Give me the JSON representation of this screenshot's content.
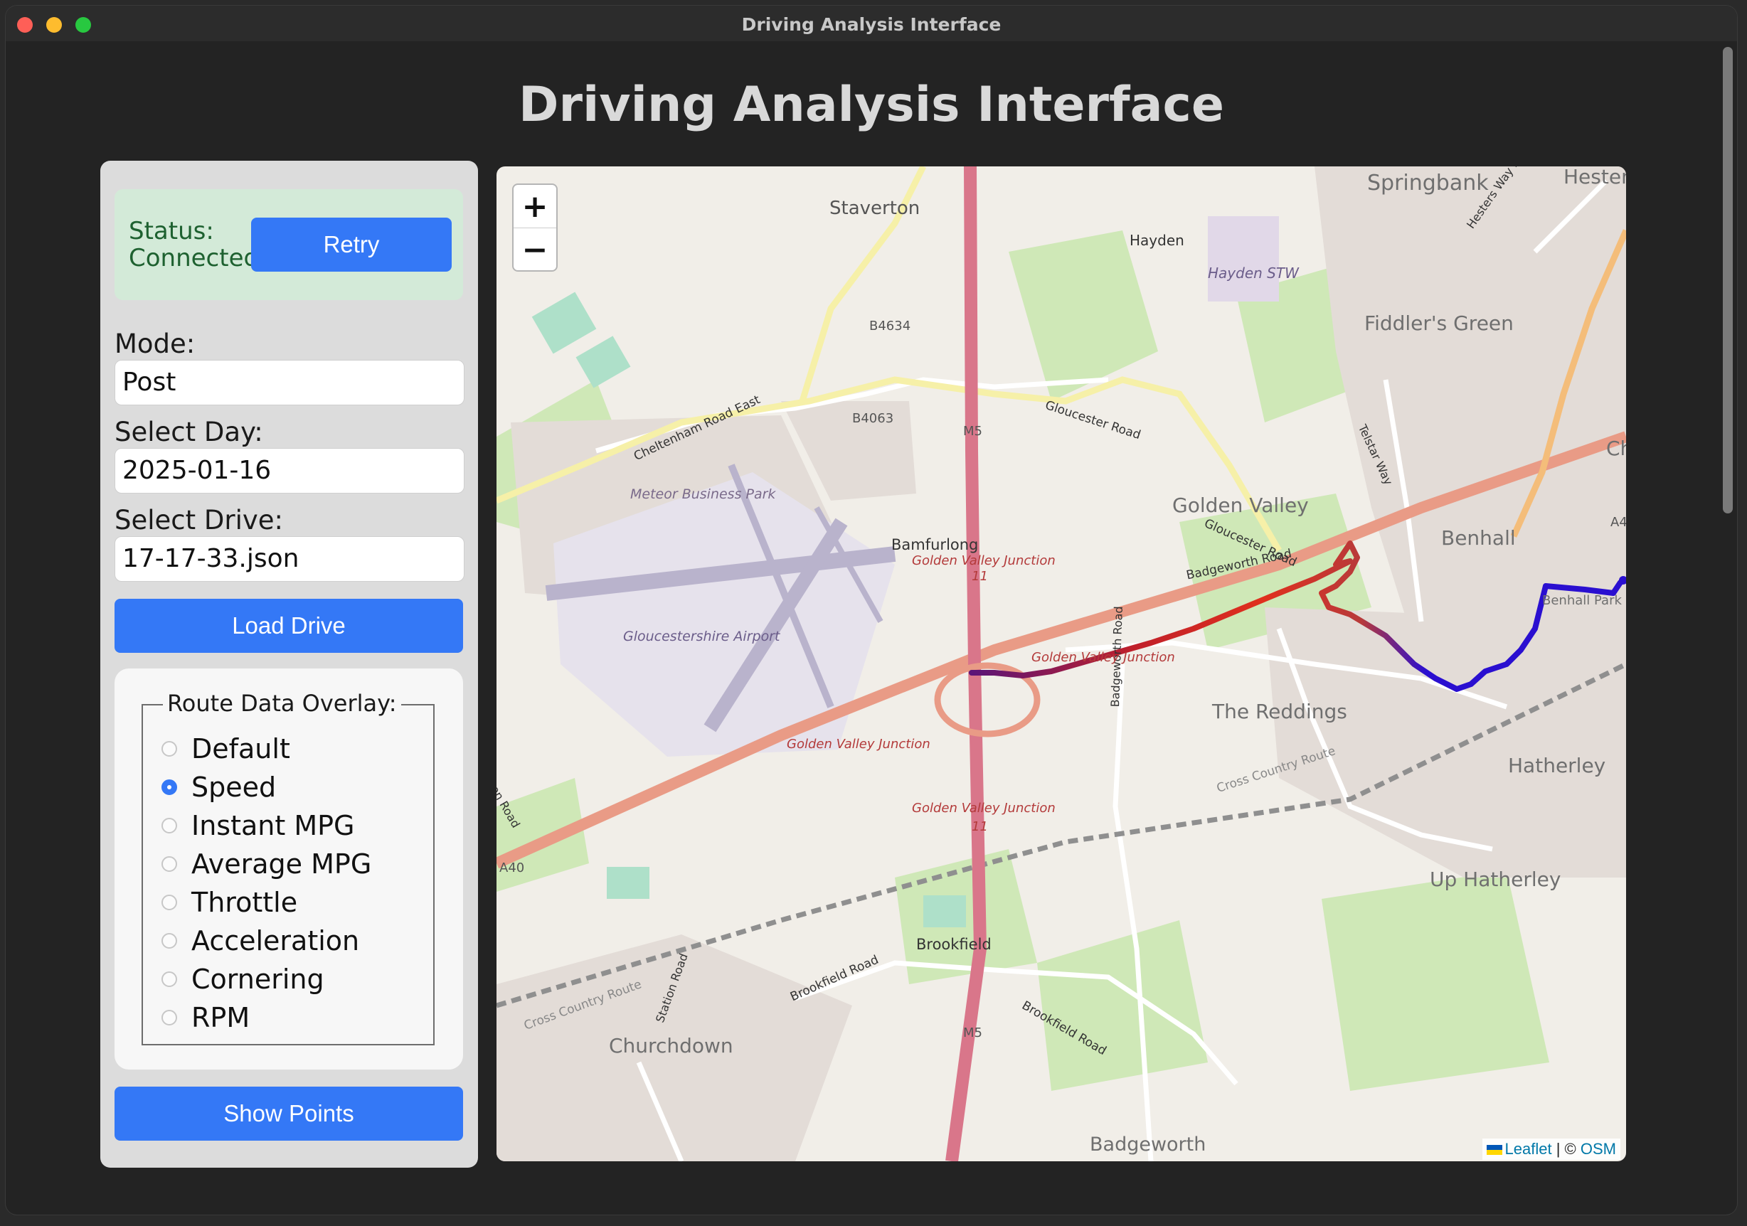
{
  "window": {
    "title": "Driving Analysis Interface"
  },
  "page": {
    "title": "Driving Analysis Interface"
  },
  "status": {
    "label": "Status:",
    "value": "Connected",
    "retry_label": "Retry"
  },
  "mode": {
    "label": "Mode:",
    "value": "Post"
  },
  "day": {
    "label": "Select Day:",
    "value": "2025-01-16"
  },
  "drive": {
    "label": "Select Drive:",
    "value": "17-17-33.json"
  },
  "load_label": "Load Drive",
  "overlay": {
    "legend": "Route Data Overlay:",
    "selected": "Speed",
    "options": [
      "Default",
      "Speed",
      "Instant MPG",
      "Average MPG",
      "Throttle",
      "Acceleration",
      "Cornering",
      "RPM"
    ]
  },
  "show_points_label": "Show Points",
  "map": {
    "zoom_in": "+",
    "zoom_out": "−",
    "attribution": {
      "leaflet": "Leaflet",
      "sep": "| ©",
      "osm": "OSM"
    },
    "places": [
      "Springbank",
      "Staverton",
      "Hayden",
      "Hayden STW",
      "Fiddler's Green",
      "Golden Valley",
      "Benhall",
      "Bamfurlong",
      "The Reddings",
      "Hatherley",
      "Up Hatherley",
      "Brookfield",
      "Churchdown",
      "Badgeworth",
      "Meteor Business Park",
      "Gloucestershire Airport",
      "Benhall Park",
      "Hester"
    ],
    "roads": [
      "B4634",
      "B4063",
      "M5",
      "M5",
      "A40",
      "A4",
      "Cheltenham Road East",
      "Gloucester Road",
      "Gloucester Road",
      "Badgeworth Road",
      "Badgeworth Road",
      "Cross Country Route",
      "Cross Country Route",
      "Brookfield Road",
      "Brookfield Road",
      "Station Road",
      "Telstar Way",
      "Hesters Way Road",
      "Cheltenham",
      "Lon Road"
    ],
    "junctions": [
      "Golden Valley Junction",
      "Golden Valley Junction",
      "Golden Valley Junction",
      "Golden Valley Junction",
      "11",
      "11"
    ],
    "route_colors": {
      "slow": "#2a0fd0",
      "mid": "#7a1a9a",
      "fast": "#e0301e"
    }
  }
}
